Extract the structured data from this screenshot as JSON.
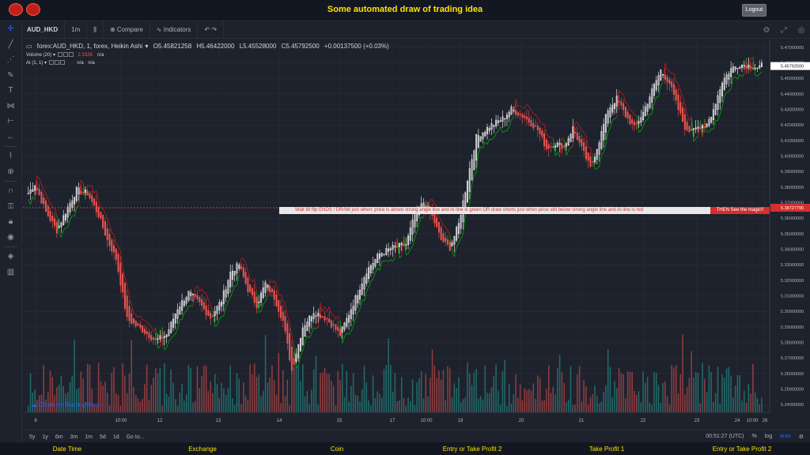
{
  "app": {
    "title": "Some automated draw of trading idea",
    "logout_label": "Logout"
  },
  "toolbar": {
    "symbol": "AUD_HKD",
    "interval": "1m",
    "compare_label": "Compare",
    "indicators_label": "Indicators"
  },
  "legend": {
    "title": "forex:AUD_HKD, 1, forex, Heikin Ashi",
    "open": "O5.45821258",
    "high": "H5.46422000",
    "low": "L5.45528000",
    "close": "C5.45792500",
    "change": "+0.00137500 (+0.03%)",
    "volume_label": "Volume (20)",
    "volume_value": "2.332K",
    "volume_na": "n/a",
    "ai_label": "AI (1, 1)",
    "ai_na1": "n/a",
    "ai_na2": "n/a"
  },
  "banner": {
    "text": "Wait till flip ENDS  !   DRAW just when:  price is above strong angle line and AI line is green        OR        draw shorts just when price still below strong angle line and AI line is red",
    "magic": "THEN See the magic!!"
  },
  "watermark": "Chart by TradingView",
  "price_labels": {
    "last": "5.45792500",
    "line": "5.38727795"
  },
  "bottom_bar": {
    "ranges": [
      "5y",
      "1y",
      "6m",
      "3m",
      "1m",
      "5d",
      "1d",
      "Go to..."
    ],
    "time": "00:51:27 (UTC)",
    "pct": "%",
    "log": "log",
    "auto": "auto"
  },
  "footer": {
    "labels": [
      "Date Time",
      "Exchange",
      "Coin",
      "Entry or Take Profit 2",
      "Take Profit 1",
      "Entry or Take Profit 2"
    ]
  },
  "colors": {
    "up": "#ffffff",
    "down": "#ef5350",
    "vol_up": "#26a69a",
    "vol_down": "#ef5350",
    "ai_green": "#00a000",
    "ai_red": "#b71c1c",
    "accent": "#ffe200"
  },
  "chart_data": {
    "type": "candlestick",
    "price_axis_ticks": [
      "5.47000000",
      "5.46000000",
      "5.45000000",
      "5.44000000",
      "5.43000000",
      "5.42000000",
      "5.41000000",
      "5.40000000",
      "5.39000000",
      "5.38000000",
      "5.37000000",
      "5.36000000",
      "5.35000000",
      "5.34000000",
      "5.33000000",
      "5.32000000",
      "5.31000000",
      "5.30000000",
      "5.29000000",
      "5.28000000",
      "5.27000000",
      "5.26000000",
      "5.25000000",
      "5.24000000"
    ],
    "time_axis_ticks": [
      "8",
      "10:00",
      "12",
      "13",
      "14",
      "15",
      "17",
      "10:00",
      "19",
      "20",
      "21",
      "22",
      "23",
      "24",
      "10:00",
      "26"
    ],
    "ylim": [
      5.235,
      5.475
    ],
    "key_points": [
      [
        0,
        5.376
      ],
      [
        3,
        5.382
      ],
      [
        8,
        5.364
      ],
      [
        13,
        5.352
      ],
      [
        18,
        5.367
      ],
      [
        22,
        5.378
      ],
      [
        27,
        5.376
      ],
      [
        32,
        5.362
      ],
      [
        36,
        5.346
      ],
      [
        40,
        5.334
      ],
      [
        45,
        5.295
      ],
      [
        52,
        5.288
      ],
      [
        58,
        5.281
      ],
      [
        63,
        5.285
      ],
      [
        68,
        5.302
      ],
      [
        73,
        5.312
      ],
      [
        78,
        5.305
      ],
      [
        83,
        5.296
      ],
      [
        88,
        5.307
      ],
      [
        92,
        5.325
      ],
      [
        96,
        5.33
      ],
      [
        100,
        5.314
      ],
      [
        104,
        5.304
      ],
      [
        108,
        5.318
      ],
      [
        112,
        5.309
      ],
      [
        116,
        5.294
      ],
      [
        120,
        5.262
      ],
      [
        125,
        5.29
      ],
      [
        130,
        5.3
      ],
      [
        136,
        5.295
      ],
      [
        142,
        5.285
      ],
      [
        148,
        5.305
      ],
      [
        154,
        5.326
      ],
      [
        160,
        5.337
      ],
      [
        166,
        5.341
      ],
      [
        172,
        5.343
      ],
      [
        176,
        5.362
      ],
      [
        180,
        5.37
      ],
      [
        184,
        5.361
      ],
      [
        188,
        5.346
      ],
      [
        192,
        5.341
      ],
      [
        196,
        5.356
      ],
      [
        200,
        5.385
      ],
      [
        204,
        5.412
      ],
      [
        210,
        5.419
      ],
      [
        216,
        5.424
      ],
      [
        220,
        5.43
      ],
      [
        226,
        5.425
      ],
      [
        232,
        5.417
      ],
      [
        236,
        5.405
      ],
      [
        240,
        5.408
      ],
      [
        244,
        5.406
      ],
      [
        248,
        5.418
      ],
      [
        252,
        5.405
      ],
      [
        256,
        5.392
      ],
      [
        260,
        5.41
      ],
      [
        264,
        5.43
      ],
      [
        268,
        5.437
      ],
      [
        272,
        5.426
      ],
      [
        276,
        5.418
      ],
      [
        280,
        5.428
      ],
      [
        284,
        5.442
      ],
      [
        288,
        5.455
      ],
      [
        292,
        5.447
      ],
      [
        296,
        5.43
      ],
      [
        300,
        5.415
      ],
      [
        304,
        5.42
      ],
      [
        308,
        5.417
      ],
      [
        312,
        5.43
      ],
      [
        316,
        5.448
      ],
      [
        320,
        5.456
      ],
      [
        324,
        5.459
      ],
      [
        328,
        5.458
      ],
      [
        332,
        5.457
      ],
      [
        334,
        5.458
      ]
    ]
  }
}
